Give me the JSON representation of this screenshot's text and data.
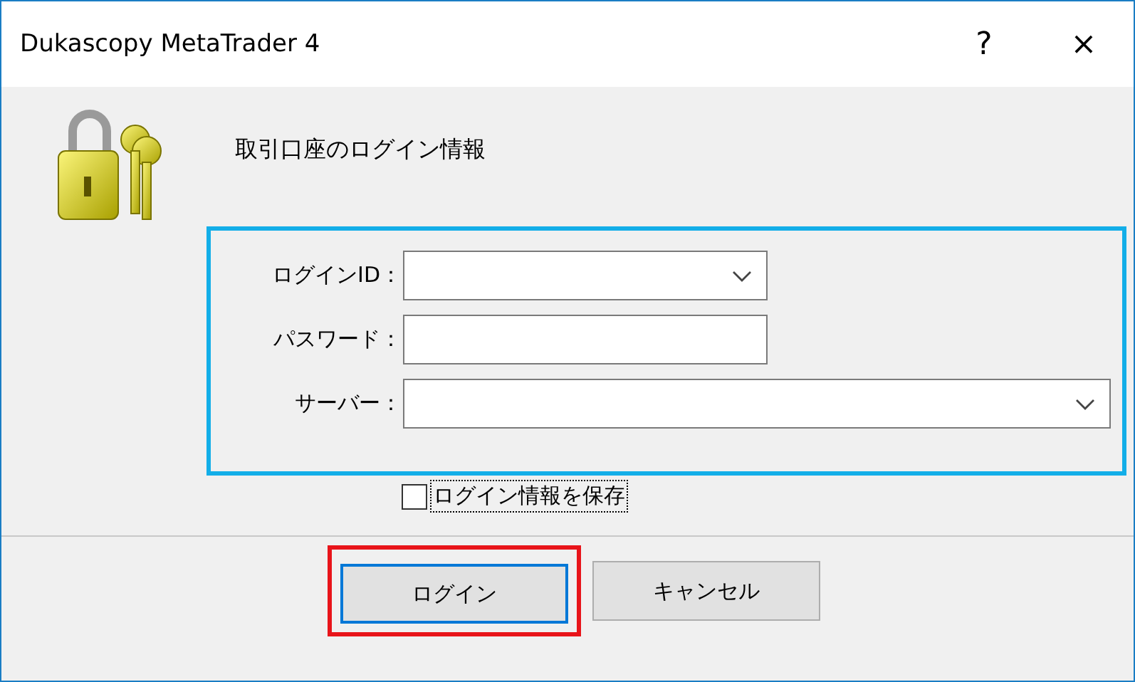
{
  "window": {
    "title": "Dukascopy MetaTrader 4",
    "help": "?",
    "close": "×"
  },
  "heading": "取引口座のログイン情報",
  "fields": [
    {
      "label": "ログインID：",
      "kind": "combo"
    },
    {
      "label": "パスワード：",
      "kind": "text"
    },
    {
      "label": "サーバー：",
      "kind": "wide_combo"
    }
  ],
  "remember": {
    "label": "ログイン情報を保存",
    "checked": false,
    "focused": true
  },
  "buttons": [
    {
      "label": "ログイン",
      "default": true
    },
    {
      "label": "キャンセル",
      "default": false
    }
  ]
}
